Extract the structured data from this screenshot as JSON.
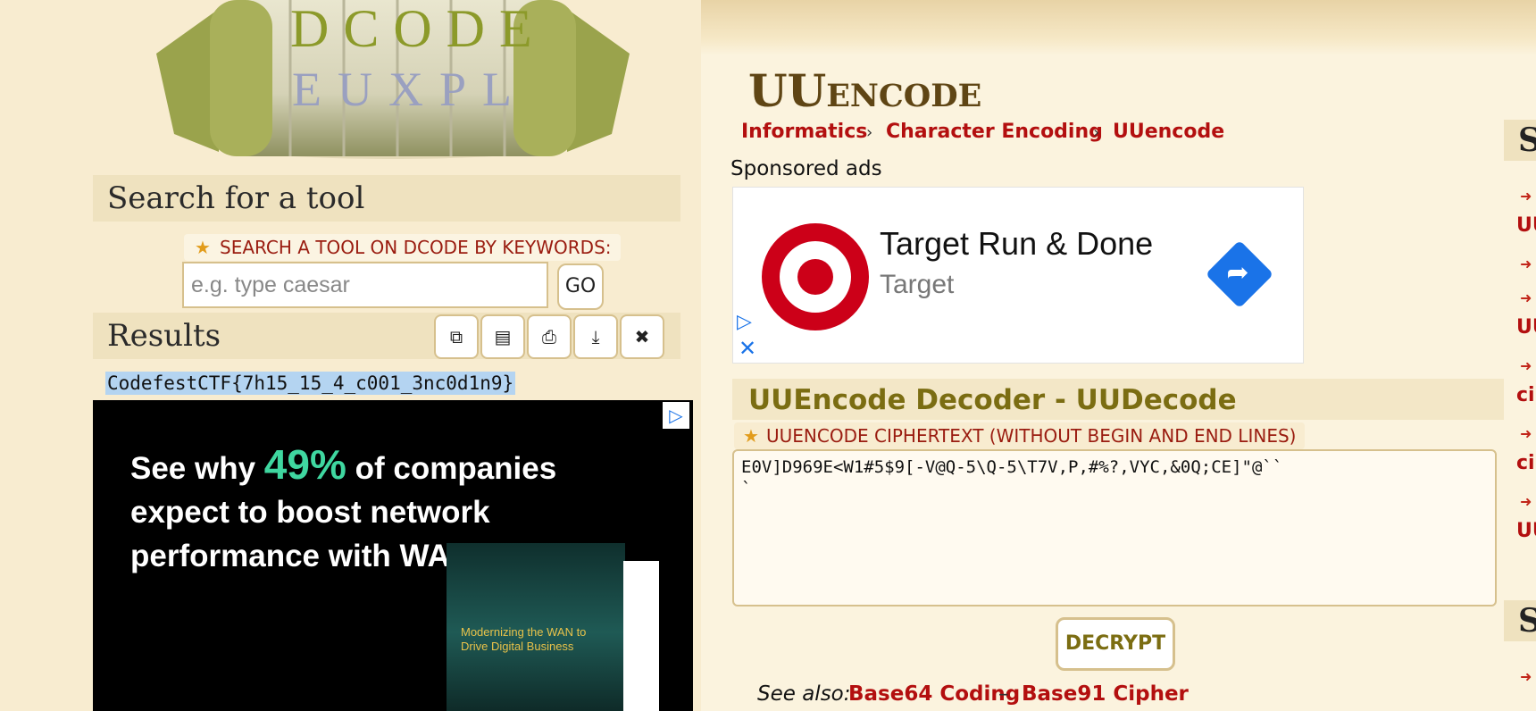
{
  "logo": {
    "letters_top": "DCODE",
    "letters_mid": "EUXPL"
  },
  "search": {
    "title": "Search for a tool",
    "keyword_label": "SEARCH A TOOL ON DCODE BY KEYWORDS:",
    "placeholder": "e.g. type caesar",
    "go_label": "GO"
  },
  "results": {
    "title": "Results",
    "tool_icons": [
      "copy-icon",
      "copy-all-icon",
      "print-icon",
      "download-icon",
      "close-icon"
    ],
    "text": "CodefestCTF{7h15_15_4_c001_3nc0d1n9}"
  },
  "left_ad": {
    "line_pre": "See why ",
    "percent": "49%",
    "line_post": " of companies expect to boost network performance with WAN updates.",
    "book_title": "Modernizing the WAN to Drive Digital Business"
  },
  "page": {
    "title": "UUencode",
    "breadcrumb": [
      "Informatics",
      "Character Encoding",
      "UUencode"
    ],
    "sponsored": "Sponsored ads"
  },
  "top_ad": {
    "title": "Target Run & Done",
    "subtitle": "Target"
  },
  "tool": {
    "title": "UUEncode Decoder - UUDecode",
    "cipher_label": "UUENCODE CIPHERTEXT (WITHOUT BEGIN AND END LINES)",
    "cipher_value": "E0V]D969E<W1#5$9[-V@Q-5\\Q-5\\T7V,P,#%?,VYC,&0Q;CE]\"@``\n`",
    "decrypt_label": "DECRYPT"
  },
  "see_also": {
    "label": "See also:",
    "links": [
      "Base64 Coding",
      "Base91 Cipher"
    ],
    "separator": "–"
  },
  "sidebar": {
    "heading_letter": "S",
    "link_fragments": [
      "UU",
      "UU",
      "ci",
      "ci",
      "UU"
    ]
  },
  "colors": {
    "background": "#f8ecd0",
    "link": "#b30f0f",
    "accent_olive": "#7b6d12",
    "selection": "#b4d4f1"
  }
}
